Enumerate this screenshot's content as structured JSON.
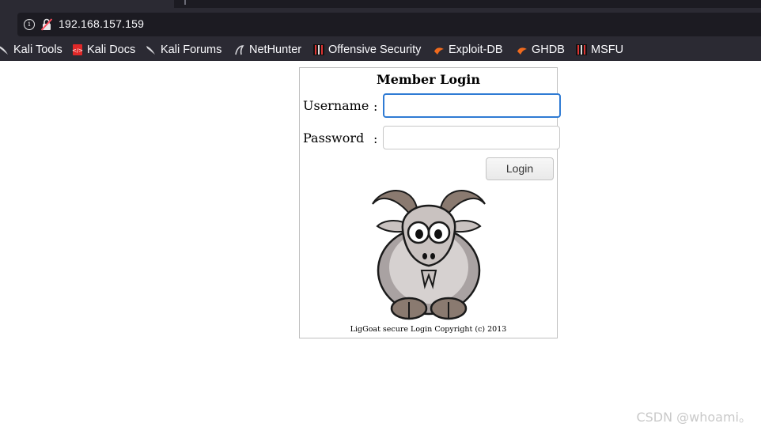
{
  "browser": {
    "url": "192.168.157.159",
    "bookmarks": [
      {
        "label": "Kali Tools",
        "icon": "kali-dragon-icon"
      },
      {
        "label": "Kali Docs",
        "icon": "kali-docs-icon"
      },
      {
        "label": "Kali Forums",
        "icon": "kali-dragon-icon"
      },
      {
        "label": "NetHunter",
        "icon": "nethunter-icon"
      },
      {
        "label": "Offensive Security",
        "icon": "offsec-icon"
      },
      {
        "label": "Exploit-DB",
        "icon": "exploitdb-icon"
      },
      {
        "label": "GHDB",
        "icon": "exploitdb-icon"
      },
      {
        "label": "MSFU",
        "icon": "offsec-icon"
      }
    ]
  },
  "login": {
    "title": "Member Login",
    "username_label": "Username",
    "password_label": "Password",
    "colon": ":",
    "username_value": "",
    "password_value": "",
    "button_label": "Login",
    "copyright": "LigGoat secure Login Copyright (c) 2013"
  },
  "watermark": "CSDN @whoami。",
  "colors": {
    "chrome_bg": "#2b2a33",
    "urlbar_bg": "#1c1b22",
    "focus_border": "#2f7bd4"
  }
}
